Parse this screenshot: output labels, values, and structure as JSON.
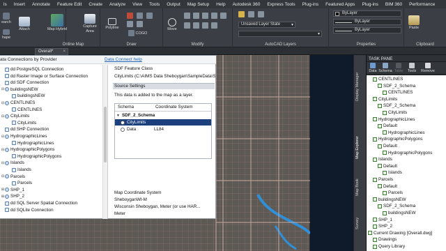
{
  "menu": [
    "ls",
    "Insert",
    "Annotate",
    "Feature Edit",
    "Create",
    "Analyze",
    "View",
    "Tools",
    "Output",
    "Map Setup",
    "Help",
    "Autodesk 360",
    "Express Tools",
    "Plug-ins",
    "Featured Apps",
    "Plug-ins",
    "BIM 360",
    "Performance"
  ],
  "ribbon": {
    "buttons": {
      "search": "earch",
      "shape": "hape",
      "attach": "Attach",
      "map_hybrid": "Map Hybrid",
      "capture_area": "Capture Area",
      "polyline": "Polyline",
      "cogo": "COGO",
      "move": "Move",
      "layer_state": "Unsaved Layer State",
      "bylayer1": "ByLayer",
      "bylayer2": "ByLayer",
      "bylayer3": "ByLayer",
      "paste": "Paste"
    },
    "groups": {
      "online_map": "Online Map",
      "draw": "Draw",
      "modify": "Modify",
      "layers": "AutoCAD Layers",
      "properties": "Properties",
      "clipboard": "Clipboard"
    }
  },
  "doc_tab": {
    "label": "Overall*",
    "close": "×"
  },
  "data_connect": {
    "header_title": "ata Connections by Provider",
    "help_link": "Data Connect help",
    "tree": [
      {
        "indent": 0,
        "expander": "",
        "icon": "add-icon",
        "label": "dd PostgreSQL Connection"
      },
      {
        "indent": 0,
        "expander": "",
        "icon": "add-icon",
        "label": "dd Raster Image or Surface Connection"
      },
      {
        "indent": 0,
        "expander": "",
        "icon": "add-icon",
        "label": "dd SDF Connection"
      },
      {
        "indent": 0,
        "expander": "⊟",
        "icon": "db-icon",
        "label": "buildingsNEW"
      },
      {
        "indent": 2,
        "expander": "",
        "icon": "layer-icon",
        "label": "buildingsNEW"
      },
      {
        "indent": 0,
        "expander": "⊟",
        "icon": "db-icon",
        "label": "CENTLINES"
      },
      {
        "indent": 2,
        "expander": "",
        "icon": "layer-icon",
        "label": "CENTLINES"
      },
      {
        "indent": 0,
        "expander": "⊟",
        "icon": "db-icon",
        "label": "CityLimits"
      },
      {
        "indent": 2,
        "expander": "",
        "icon": "layer-icon",
        "label": "CityLimits"
      },
      {
        "indent": 0,
        "expander": "",
        "icon": "add-icon",
        "label": "dd SHP Connection"
      },
      {
        "indent": 0,
        "expander": "⊟",
        "icon": "db-icon",
        "label": "HydrographicLines"
      },
      {
        "indent": 2,
        "expander": "",
        "icon": "layer-icon",
        "label": "HydrographicLines"
      },
      {
        "indent": 0,
        "expander": "⊟",
        "icon": "db-icon",
        "label": "HydrographicPolygons"
      },
      {
        "indent": 2,
        "expander": "",
        "icon": "layer-icon",
        "label": "HydrographicPolygons"
      },
      {
        "indent": 0,
        "expander": "⊟",
        "icon": "db-icon",
        "label": "Islands"
      },
      {
        "indent": 2,
        "expander": "",
        "icon": "layer-icon",
        "label": "Islands"
      },
      {
        "indent": 0,
        "expander": "⊟",
        "icon": "db-icon",
        "label": "Parcels"
      },
      {
        "indent": 2,
        "expander": "",
        "icon": "layer-icon",
        "label": "Parcels"
      },
      {
        "indent": 0,
        "expander": "⊞",
        "icon": "db-icon",
        "label": "SHP_1"
      },
      {
        "indent": 0,
        "expander": "⊞",
        "icon": "db-icon",
        "label": "SHP_2"
      },
      {
        "indent": 0,
        "expander": "",
        "icon": "add-icon",
        "label": "dd SQL Server Spatial Connection"
      },
      {
        "indent": 0,
        "expander": "",
        "icon": "add-icon",
        "label": "dd SQLite Connection"
      }
    ],
    "detail": {
      "title": "SDF Feature Class",
      "path": "CityLimits (C:\\AIMS Data Sheboygan\\SampleData\\S",
      "section": "Source Settings",
      "info": "This data is added to the map as a layer.",
      "columns": [
        "Schema",
        "Coordinate System"
      ],
      "rows": [
        {
          "label": "SDF_2_Schema",
          "cs": "",
          "kind": "schema"
        },
        {
          "label": "CityLimits",
          "cs": "",
          "kind": "selected"
        },
        {
          "label": "Data",
          "cs": "LL84",
          "kind": "normal"
        }
      ],
      "mcs_heading": "Map Coordinate System",
      "mcs_code": "SheboyganWI-M",
      "mcs_desc": "Wisconsin Sheboygan, Meter (or use HAR...",
      "mcs_unit": "Meter"
    }
  },
  "side_tabs": [
    "Display Manager",
    "Map Explorer",
    "Map Book",
    "Survey"
  ],
  "task_pane": {
    "title": "TASK PANE",
    "tools": [
      "Data",
      "Schema",
      "Table",
      "Tools",
      "Remove"
    ],
    "items": [
      {
        "indent": 0,
        "label": "CENTLINES"
      },
      {
        "indent": 1,
        "label": "SDF_2_Schema"
      },
      {
        "indent": 2,
        "label": "CENTLINES"
      },
      {
        "indent": 0,
        "label": "CityLimits"
      },
      {
        "indent": 1,
        "label": "SDF_2_Schema"
      },
      {
        "indent": 2,
        "label": "CityLimits"
      },
      {
        "indent": 0,
        "label": "HydrographicLines"
      },
      {
        "indent": 1,
        "label": "Default"
      },
      {
        "indent": 2,
        "label": "HydrographicLines"
      },
      {
        "indent": 0,
        "label": "HydrographicPolygons"
      },
      {
        "indent": 1,
        "label": "Default"
      },
      {
        "indent": 2,
        "label": "HydrographicPolygons"
      },
      {
        "indent": 0,
        "label": "Islands"
      },
      {
        "indent": 1,
        "label": "Default"
      },
      {
        "indent": 2,
        "label": "Islands"
      },
      {
        "indent": 0,
        "label": "Parcels"
      },
      {
        "indent": 1,
        "label": "Default"
      },
      {
        "indent": 2,
        "label": "Parcels"
      },
      {
        "indent": 0,
        "label": "buildingsNEW"
      },
      {
        "indent": 1,
        "label": "SDF_2_Schema"
      },
      {
        "indent": 2,
        "label": "buildingsNEW"
      },
      {
        "indent": 0,
        "label": "SHP_1"
      },
      {
        "indent": 0,
        "label": "SHP_2"
      },
      {
        "indent": -1,
        "label": "Current Drawing [Overall.dwg]"
      },
      {
        "indent": 0,
        "label": "Drawings"
      },
      {
        "indent": 0,
        "label": "Query Library"
      }
    ]
  },
  "colors": {
    "accent": "#1c3f7d",
    "ribbon_bg": "#3b3f45",
    "map_bg": "#4a4946",
    "water": "#2f8fd8",
    "lake": "#0f1a2a"
  }
}
